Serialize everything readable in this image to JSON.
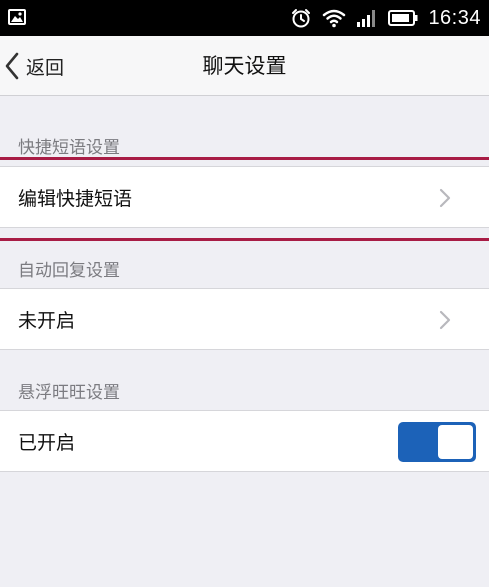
{
  "status_bar": {
    "time": "16:34",
    "icons": [
      "gallery-icon",
      "alarm-icon",
      "wifi-icon",
      "signal-icon",
      "battery-icon"
    ]
  },
  "nav": {
    "back_label": "返回",
    "title": "聊天设置"
  },
  "sections": [
    {
      "header": "快捷短语设置",
      "row_label": "编辑快捷短语",
      "control": "chevron"
    },
    {
      "header": "自动回复设置",
      "row_label": "未开启",
      "control": "chevron"
    },
    {
      "header": "悬浮旺旺设置",
      "row_label": "已开启",
      "control": "toggle",
      "toggle_on": true
    }
  ],
  "colors": {
    "accent": "#1c62b8",
    "highlight": "#a81c45",
    "background": "#efeff4"
  }
}
